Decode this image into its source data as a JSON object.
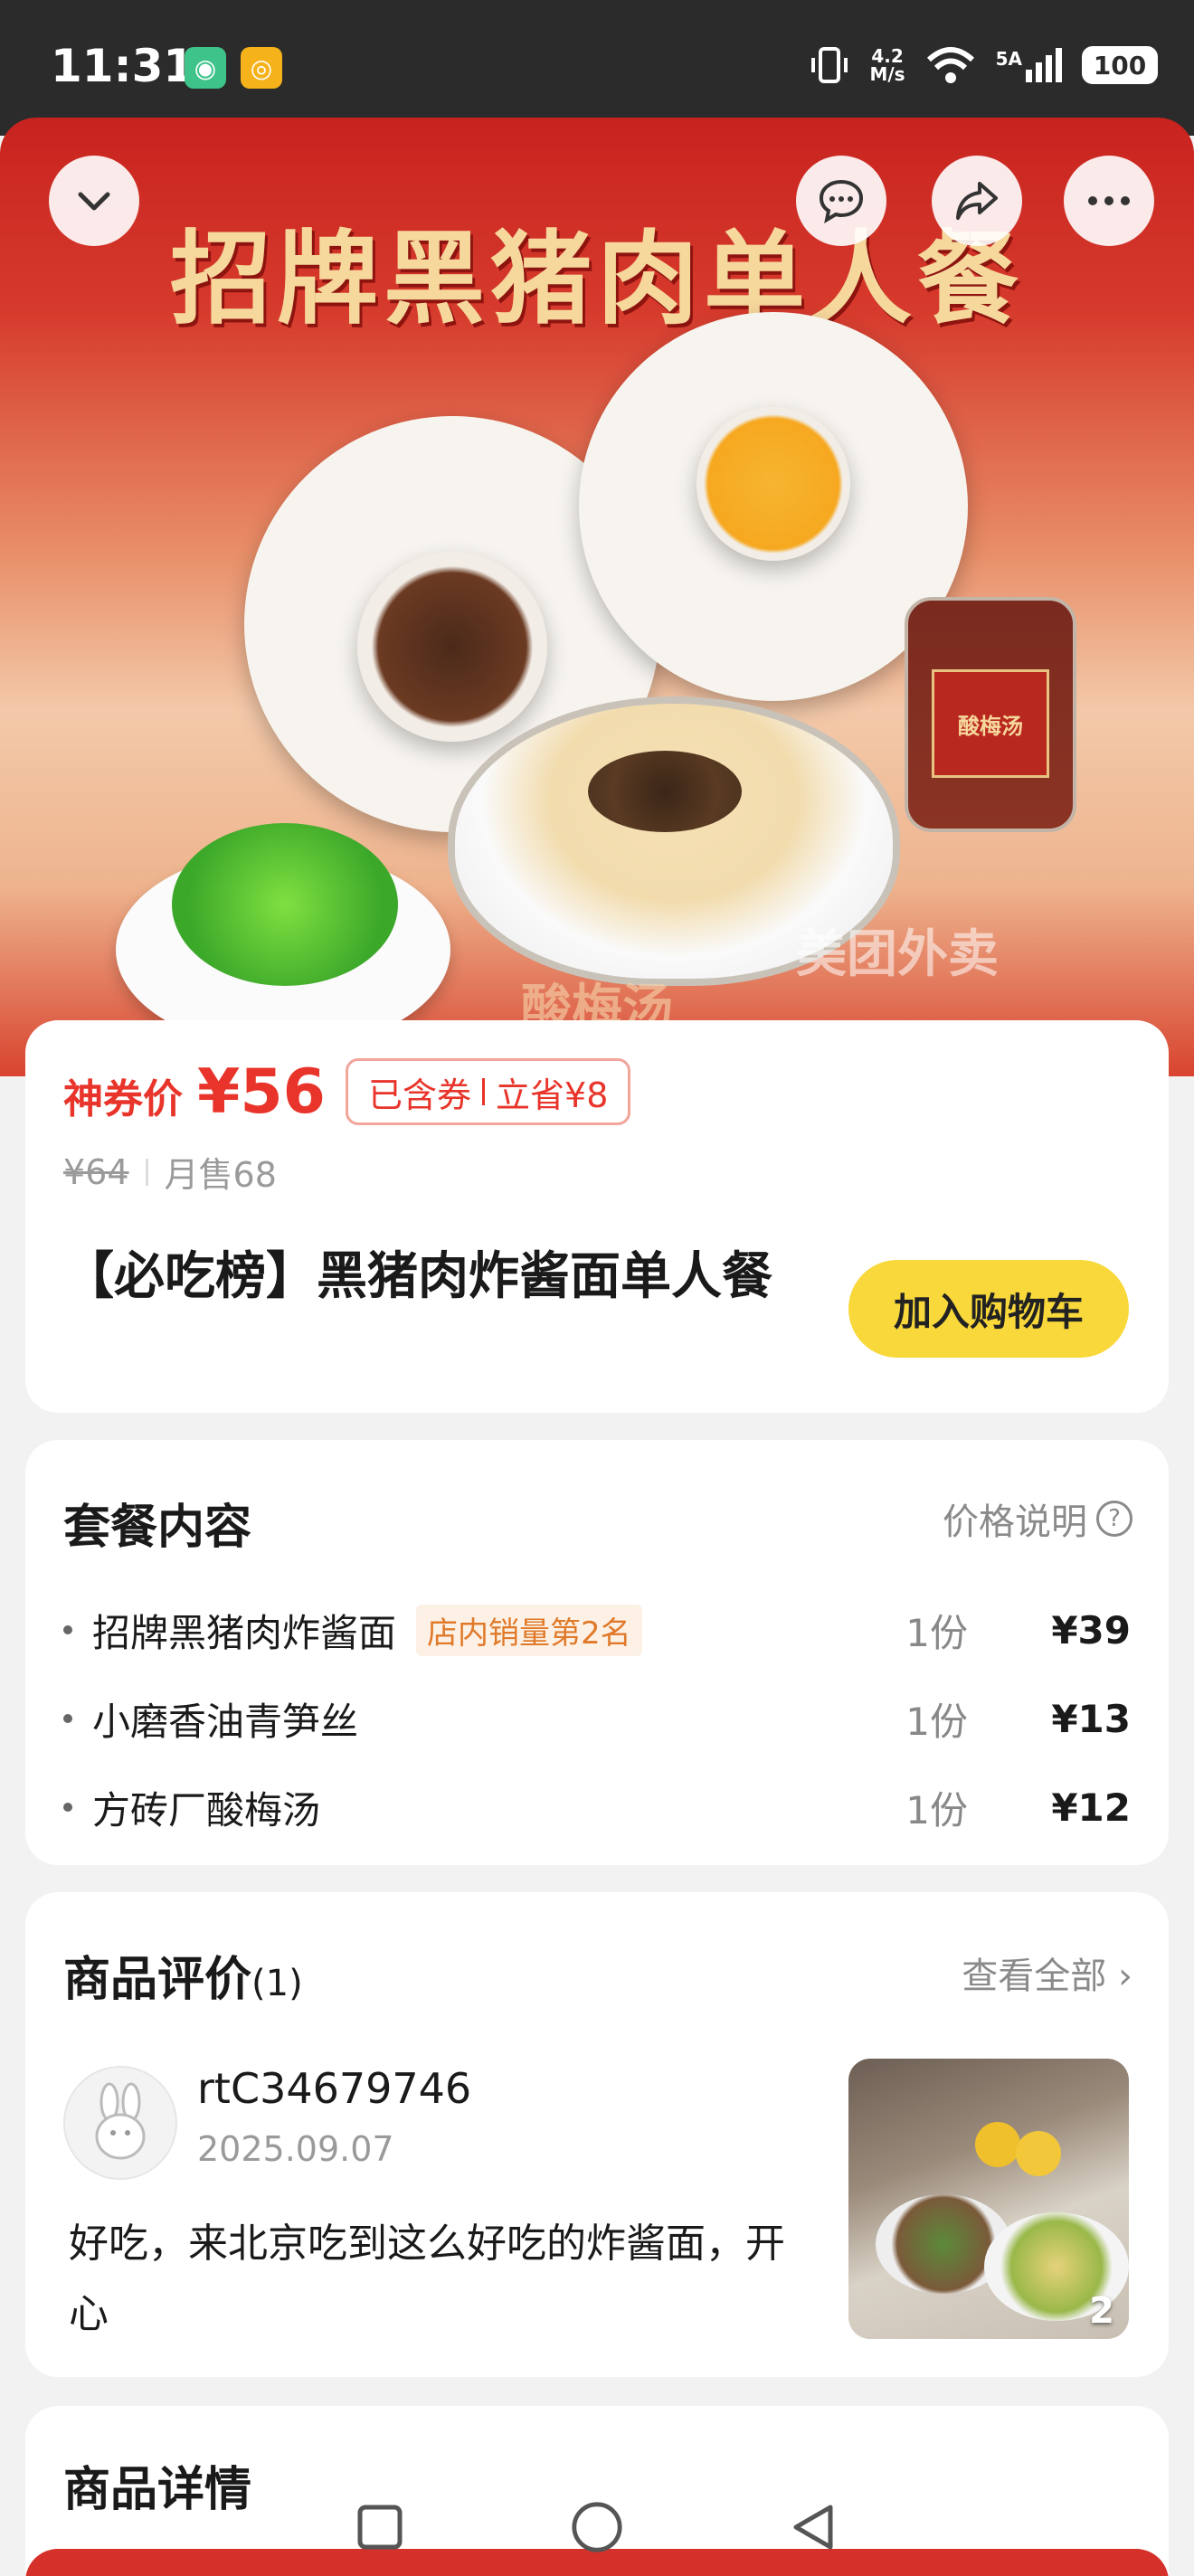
{
  "status_bar": {
    "time": "11:31",
    "network_speed_value": "4.2",
    "network_speed_unit": "M/s",
    "cell_label": "5A",
    "battery": "100"
  },
  "hero": {
    "title": "招牌黑猪肉单人餐",
    "subtitle": "酸梅汤",
    "jar_label": "酸梅汤",
    "watermark": "美团外卖"
  },
  "product": {
    "price_label": "神券价",
    "price_value": "¥56",
    "badge_coupon": "已含券",
    "badge_save": "立省¥8",
    "original_price": "¥64",
    "monthly_sales": "月售68",
    "name": "【必吃榜】黑猪肉炸酱面单人餐",
    "cart_button": "加入购物车"
  },
  "combo": {
    "title": "套餐内容",
    "price_note": "价格说明",
    "items": [
      {
        "name": "招牌黑猪肉炸酱面",
        "tag": "店内销量第2名",
        "qty": "1份",
        "price": "¥39"
      },
      {
        "name": "小磨香油青笋丝",
        "tag": "",
        "qty": "1份",
        "price": "¥13"
      },
      {
        "name": "方砖厂酸梅汤",
        "tag": "",
        "qty": "1份",
        "price": "¥12"
      }
    ]
  },
  "reviews": {
    "title": "商品评价",
    "count": "(1)",
    "view_all": "查看全部",
    "reviewer": "rtC34679746",
    "date": "2025.09.07",
    "text": "好吃，来北京吃到这么好吃的炸酱面，开心",
    "photo_count": "2"
  },
  "detail": {
    "title": "商品详情"
  },
  "colors": {
    "accent_red": "#e8342a",
    "cart_yellow": "#f8d83a",
    "tag_orange": "#e07a2a"
  }
}
